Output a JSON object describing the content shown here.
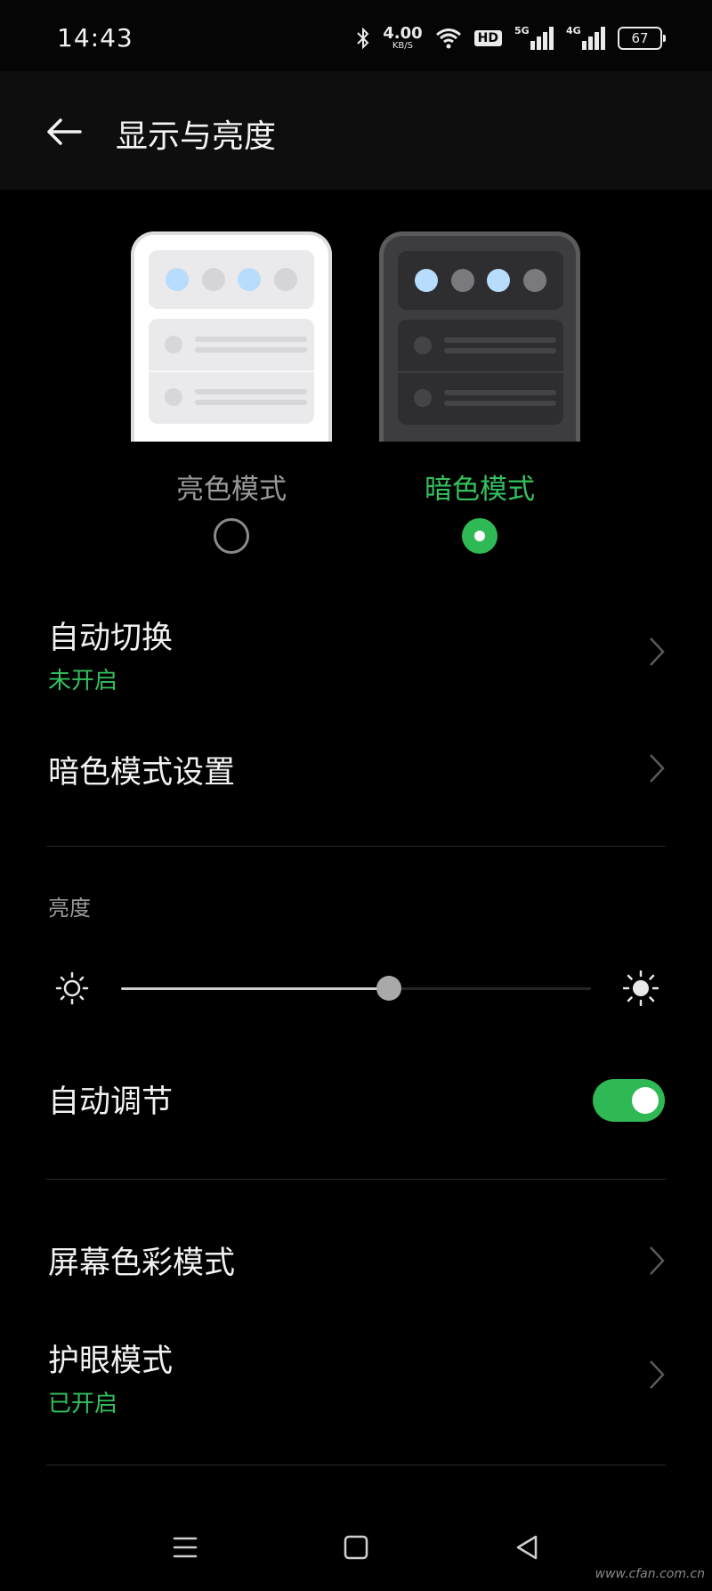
{
  "status_bar": {
    "time": "14:43",
    "net_speed_value": "4.00",
    "net_speed_unit": "KB/S",
    "hd_label": "HD",
    "signal1_label": "5G",
    "signal2_label": "4G",
    "battery": "67",
    "icons": [
      "bluetooth-icon",
      "wifi-icon",
      "signal-icon",
      "battery-icon"
    ]
  },
  "header": {
    "title": "显示与亮度",
    "back_icon": "arrow-left-icon"
  },
  "theme_modes": {
    "light_label": "亮色模式",
    "dark_label": "暗色模式",
    "selected": "dark",
    "accent_color": "#2fb955"
  },
  "settings": {
    "auto_switch": {
      "title": "自动切换",
      "status": "未开启"
    },
    "dark_mode_settings": {
      "title": "暗色模式设置"
    },
    "brightness_section": "亮度",
    "brightness_level": 0.57,
    "auto_adjust": {
      "title": "自动调节",
      "enabled": true
    },
    "screen_color_mode": {
      "title": "屏幕色彩模式"
    },
    "eye_care_mode": {
      "title": "护眼模式",
      "status": "已开启"
    }
  },
  "nav_bar": {
    "icons": [
      "menu-icon",
      "home-square-icon",
      "back-triangle-icon"
    ]
  },
  "watermark": "www.cfan.com.cn"
}
